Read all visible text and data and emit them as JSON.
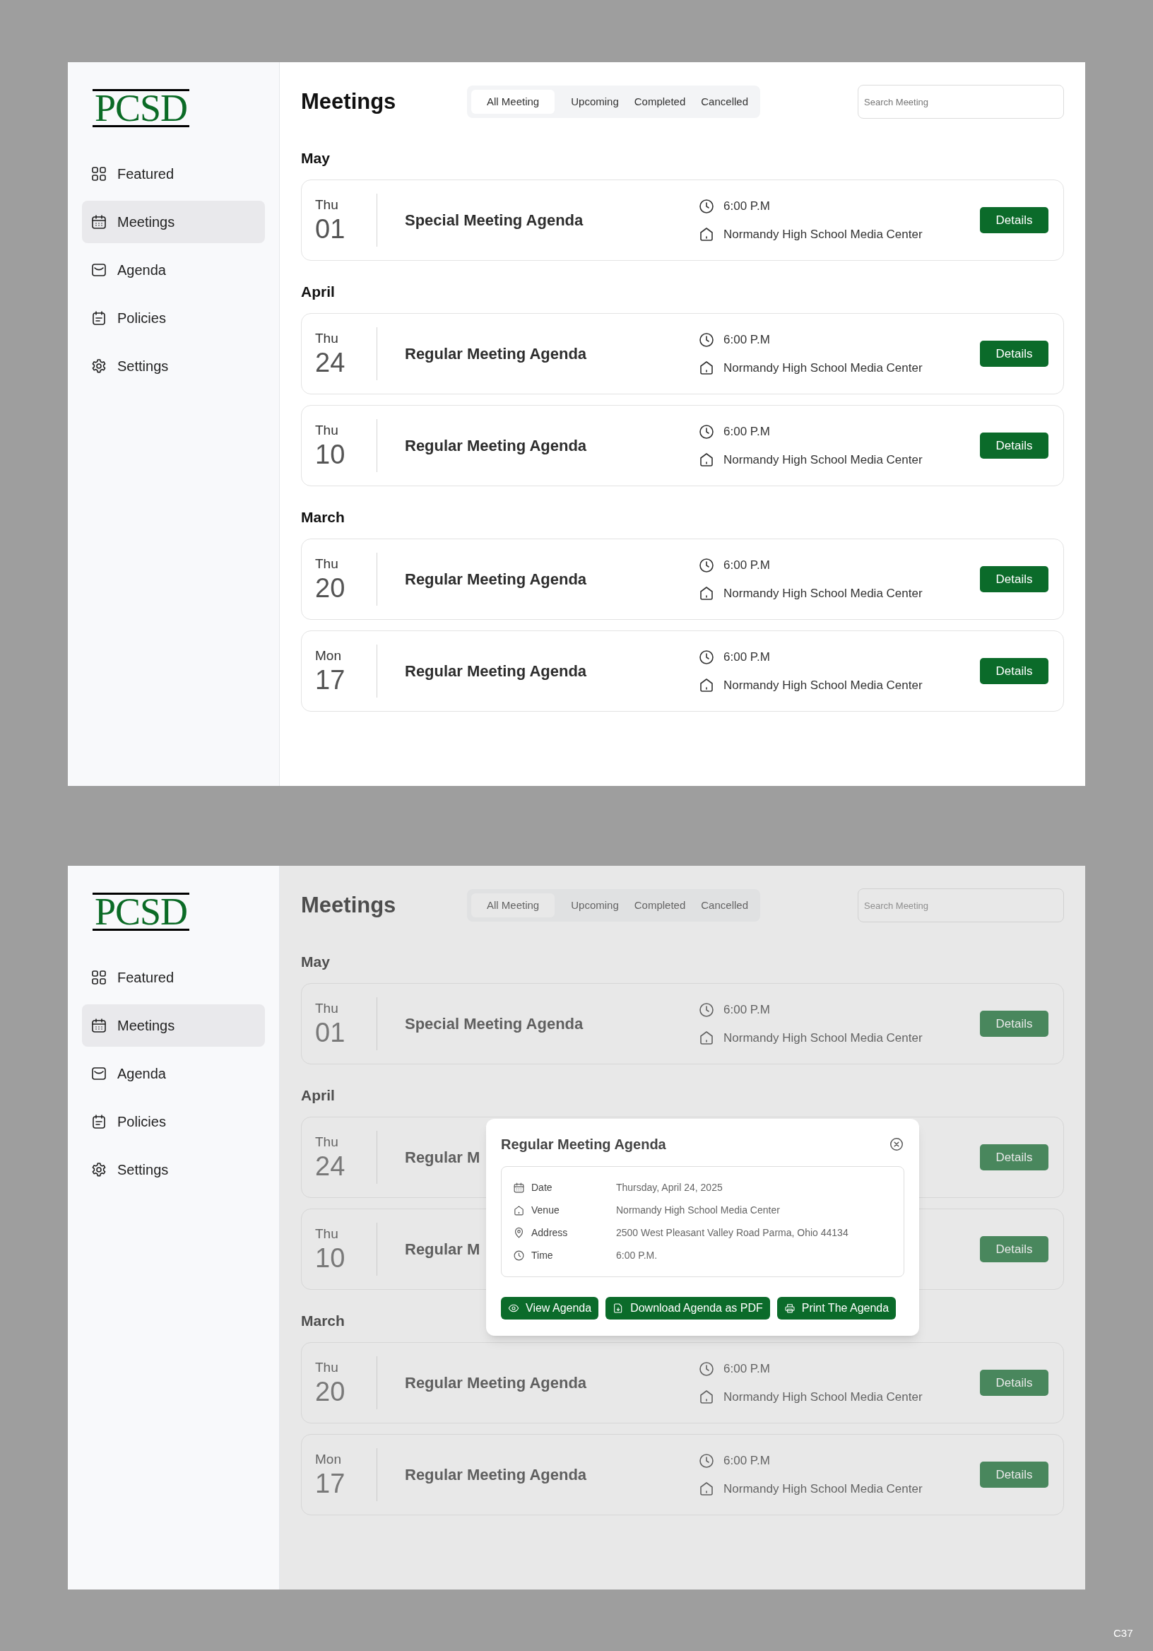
{
  "screens": [
    {
      "sidebar": {
        "logo": "PCSD",
        "items": [
          {
            "label": "Featured",
            "selected": false
          },
          {
            "label": "Meetings",
            "selected": true
          },
          {
            "label": "Agenda",
            "selected": false
          },
          {
            "label": "Policies",
            "selected": false
          },
          {
            "label": "Settings",
            "selected": false
          }
        ]
      },
      "title": "Meetings",
      "tabs": [
        {
          "label": "All Meeting",
          "selected": true
        },
        {
          "label": "Upcoming",
          "selected": false
        },
        {
          "label": "Completed",
          "selected": false
        },
        {
          "label": "Cancelled",
          "selected": false
        }
      ],
      "search": {
        "placeholder": "Search Meeting"
      },
      "groups": [
        {
          "month": "May",
          "meetings": [
            {
              "weekday": "Thu",
              "day": "01",
              "title": "Special Meeting Agenda",
              "time": "6:00 P.M",
              "venue": "Normandy High School Media Center",
              "button": "Details"
            }
          ]
        },
        {
          "month": "April",
          "meetings": [
            {
              "weekday": "Thu",
              "day": "24",
              "title": "Regular Meeting Agenda",
              "time": "6:00 P.M",
              "venue": "Normandy High School Media Center",
              "button": "Details"
            },
            {
              "weekday": "Thu",
              "day": "10",
              "title": "Regular Meeting Agenda",
              "time": "6:00 P.M",
              "venue": "Normandy High School Media Center",
              "button": "Details"
            }
          ]
        },
        {
          "month": "March",
          "meetings": [
            {
              "weekday": "Thu",
              "day": "20",
              "title": "Regular Meeting Agenda",
              "time": "6:00 P.M",
              "venue": "Normandy High School Media Center",
              "button": "Details"
            },
            {
              "weekday": "Mon",
              "day": "17",
              "title": "Regular Meeting Agenda",
              "time": "6:00 P.M",
              "venue": "Normandy High School Media Center",
              "button": "Details"
            }
          ]
        }
      ]
    },
    {
      "sidebar": {
        "logo": "PCSD",
        "items": [
          {
            "label": "Featured",
            "selected": false
          },
          {
            "label": "Meetings",
            "selected": true
          },
          {
            "label": "Agenda",
            "selected": false
          },
          {
            "label": "Policies",
            "selected": false
          },
          {
            "label": "Settings",
            "selected": false
          }
        ]
      },
      "title": "Meetings",
      "tabs": [
        {
          "label": "All Meeting",
          "selected": true
        },
        {
          "label": "Upcoming",
          "selected": false
        },
        {
          "label": "Completed",
          "selected": false
        },
        {
          "label": "Cancelled",
          "selected": false
        }
      ],
      "search": {
        "placeholder": "Search Meeting"
      },
      "groups": [
        {
          "month": "May",
          "meetings": [
            {
              "weekday": "Thu",
              "day": "01",
              "title": "Special Meeting Agenda",
              "time": "6:00 P.M",
              "venue": "Normandy High School Media Center",
              "button": "Details"
            }
          ]
        },
        {
          "month": "April",
          "meetings": [
            {
              "weekday": "Thu",
              "day": "24",
              "title": "Regular M",
              "button": "Details"
            },
            {
              "weekday": "Thu",
              "day": "10",
              "title": "Regular M",
              "button": "Details"
            }
          ]
        },
        {
          "month": "March",
          "meetings": [
            {
              "weekday": "Thu",
              "day": "20",
              "title": "Regular Meeting Agenda",
              "time": "6:00 P.M",
              "venue": "Normandy High School Media Center",
              "button": "Details"
            },
            {
              "weekday": "Mon",
              "day": "17",
              "title": "Regular Meeting Agenda",
              "time": "6:00 P.M",
              "venue": "Normandy High School Media Center",
              "button": "Details"
            }
          ]
        }
      ],
      "dialog": {
        "title": "Regular Meeting Agenda",
        "rows": [
          {
            "label": "Date",
            "value": "Thursday, April 24, 2025"
          },
          {
            "label": "Venue",
            "value": "Normandy High School Media Center"
          },
          {
            "label": "Address",
            "value": "2500 West Pleasant Valley Road Parma, Ohio 44134"
          },
          {
            "label": "Time",
            "value": "6:00 P.M."
          }
        ],
        "buttons": [
          "View Agenda",
          "Download Agenda as PDF",
          "Print The Agenda"
        ]
      }
    }
  ],
  "corner_label": "C37"
}
